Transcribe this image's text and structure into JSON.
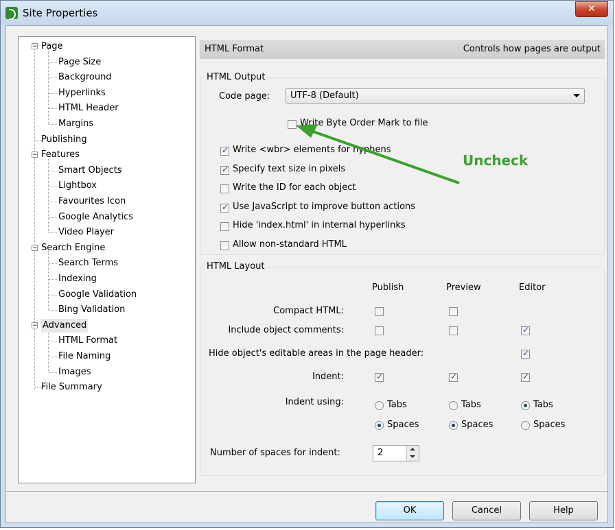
{
  "window": {
    "title": "Site Properties"
  },
  "tree": {
    "items": [
      {
        "label": "Page",
        "level": 0,
        "expanded": true
      },
      {
        "label": "Page Size",
        "level": 1
      },
      {
        "label": "Background",
        "level": 1
      },
      {
        "label": "Hyperlinks",
        "level": 1
      },
      {
        "label": "HTML Header",
        "level": 1
      },
      {
        "label": "Margins",
        "level": 1
      },
      {
        "label": "Publishing",
        "level": 0
      },
      {
        "label": "Features",
        "level": 0,
        "expanded": true
      },
      {
        "label": "Smart Objects",
        "level": 1
      },
      {
        "label": "Lightbox",
        "level": 1
      },
      {
        "label": "Favourites Icon",
        "level": 1
      },
      {
        "label": "Google Analytics",
        "level": 1
      },
      {
        "label": "Video Player",
        "level": 1
      },
      {
        "label": "Search Engine",
        "level": 0,
        "expanded": true
      },
      {
        "label": "Search Terms",
        "level": 1
      },
      {
        "label": "Indexing",
        "level": 1
      },
      {
        "label": "Google Validation",
        "level": 1
      },
      {
        "label": "Bing Validation",
        "level": 1
      },
      {
        "label": "Advanced",
        "level": 0,
        "expanded": true,
        "selected": true
      },
      {
        "label": "HTML Format",
        "level": 1
      },
      {
        "label": "File Naming",
        "level": 1
      },
      {
        "label": "Images",
        "level": 1
      },
      {
        "label": "File Summary",
        "level": 0
      }
    ]
  },
  "header": {
    "title": "HTML Format",
    "description": "Controls how pages are output"
  },
  "html_output": {
    "group_title": "HTML Output",
    "code_page_label": "Code page:",
    "code_page_value": "UTF-8 (Default)",
    "options": [
      {
        "label": "Write Byte Order Mark to file",
        "checked": false
      },
      {
        "label": "Write <wbr> elements for hyphens",
        "checked": true
      },
      {
        "label": "Specify text size in pixels",
        "checked": true
      },
      {
        "label": "Write the ID for each object",
        "checked": false
      },
      {
        "label": "Use JavaScript to improve button actions",
        "checked": true
      },
      {
        "label": "Hide 'index.html' in internal hyperlinks",
        "checked": false
      },
      {
        "label": "Allow non-standard HTML",
        "checked": false
      }
    ]
  },
  "html_layout": {
    "group_title": "HTML Layout",
    "columns": [
      "Publish",
      "Preview",
      "Editor"
    ],
    "rows": [
      {
        "label": "Compact HTML:",
        "publish": false,
        "preview": false,
        "editor": null
      },
      {
        "label": "Include object comments:",
        "publish": false,
        "preview": false,
        "editor": true
      },
      {
        "label": "Hide object's editable areas in the page header:",
        "publish": null,
        "preview": null,
        "editor": true
      },
      {
        "label": "Indent:",
        "publish": true,
        "preview": true,
        "editor": true
      }
    ],
    "indent_using_label": "Indent using:",
    "indent_options": [
      "Tabs",
      "Spaces"
    ],
    "indent_selection": {
      "publish": "Spaces",
      "preview": "Spaces",
      "editor": "Tabs"
    },
    "spaces_label": "Number of spaces for indent:",
    "spaces_value": "2"
  },
  "annotation": {
    "text": "Uncheck",
    "color": "#3aa12e"
  },
  "buttons": {
    "ok": "OK",
    "cancel": "Cancel",
    "help": "Help"
  }
}
